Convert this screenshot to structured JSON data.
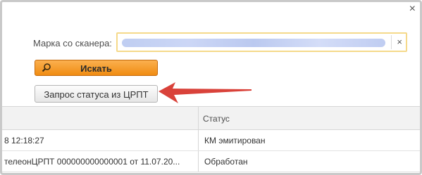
{
  "window": {
    "close_glyph": "×"
  },
  "form": {
    "scanner_label": "Марка со сканера:",
    "scanner_value": "",
    "clear_glyph": "×"
  },
  "buttons": {
    "search_label": "Искать",
    "search_icon": "search-icon",
    "status_label": "Запрос статуса из ЦРПТ"
  },
  "table": {
    "headers": {
      "status": "Статус"
    },
    "rows": [
      {
        "document": "8 12:18:27",
        "status": "КМ эмитирован"
      },
      {
        "document": "телеонЦРПТ 000000000000001 от 11.07.20...",
        "status": "Обработан"
      }
    ]
  },
  "colors": {
    "accent_orange": "#f5a02a",
    "annotation_arrow": "#d9423a"
  }
}
